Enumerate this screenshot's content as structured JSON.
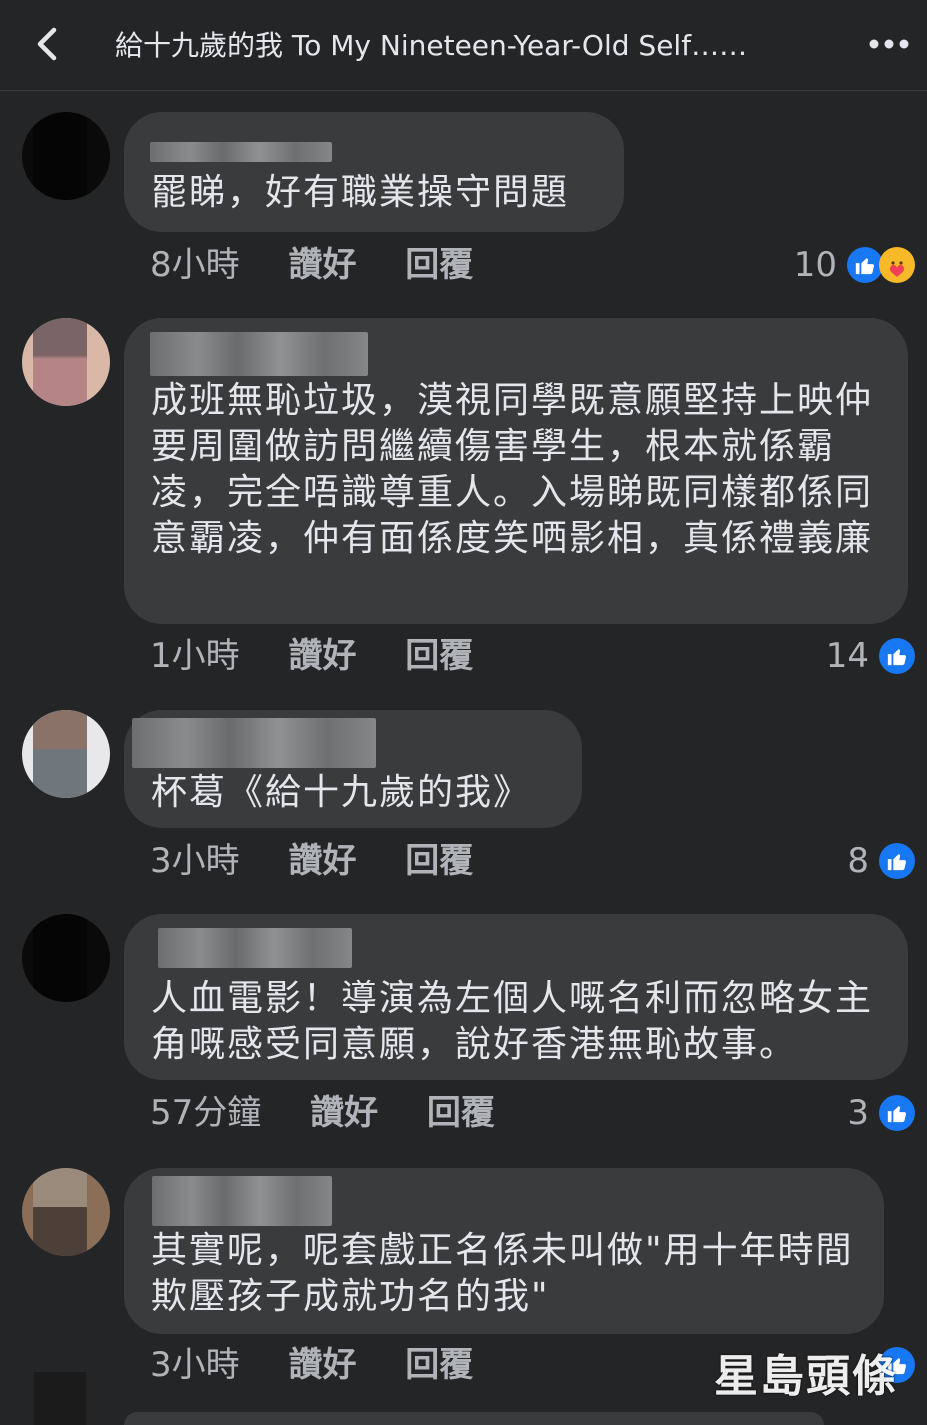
{
  "header": {
    "title": "給十九歲的我  To My Nineteen-Year-Old Self……"
  },
  "comments": [
    {
      "text": "罷睇，好有職業操守問題",
      "time": "8小時",
      "like": "讚好",
      "reply": "回覆",
      "count": "10",
      "reactions": [
        "like-icon",
        "care-icon"
      ]
    },
    {
      "text": "成班無恥垃圾，漠視同學既意願堅持上映仲要周圍做訪問繼續傷害學生，根本就係霸凌，完全唔識尊重人。入場睇既同樣都係同意霸凌，仲有面係度笑哂影相，真係禮義廉",
      "time": "1小時",
      "like": "讚好",
      "reply": "回覆",
      "count": "14",
      "reactions": [
        "like-icon"
      ]
    },
    {
      "text": "杯葛《給十九歲的我》",
      "time": "3小時",
      "like": "讚好",
      "reply": "回覆",
      "count": "8",
      "reactions": [
        "like-icon"
      ]
    },
    {
      "text": "人血電影！導演為左個人嘅名利而忽略女主角嘅感受同意願，說好香港無恥故事。",
      "time": "57分鐘",
      "like": "讚好",
      "reply": "回覆",
      "count": "3",
      "reactions": [
        "like-icon"
      ]
    },
    {
      "text": "其實呢，呢套戲正名係未叫做\"用十年時間欺壓孩子成就功名的我\"",
      "time": "3小時",
      "like": "讚好",
      "reply": "回覆",
      "count": "",
      "reactions": [
        "like-icon"
      ]
    }
  ],
  "watermark": {
    "text": "星島頭條"
  },
  "colors": {
    "background": "#242526",
    "bubble": "#3a3b3c",
    "text": "#e4e6eb",
    "meta": "#b0b3b8",
    "like_blue": "#1877f2",
    "care_yellow": "#f7b928"
  }
}
